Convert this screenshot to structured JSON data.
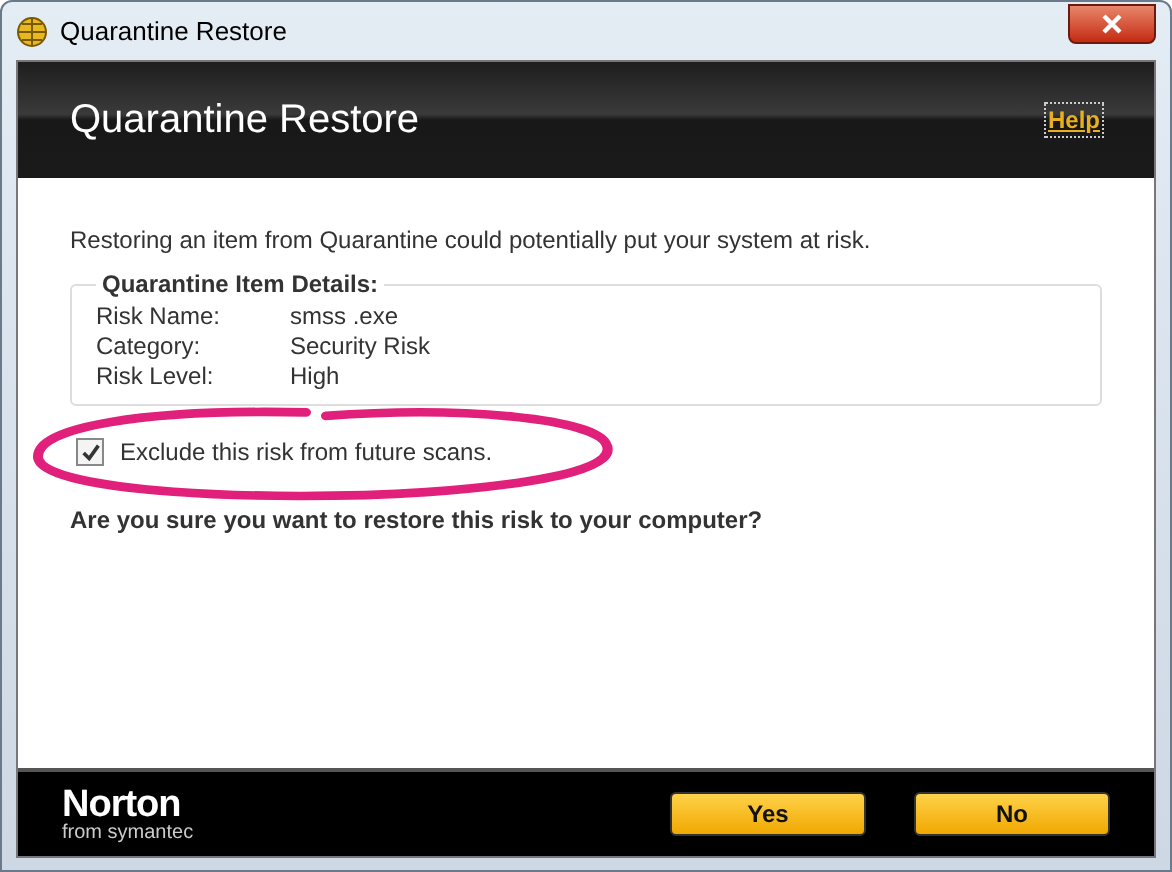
{
  "window": {
    "title": "Quarantine Restore"
  },
  "header": {
    "title": "Quarantine Restore",
    "help_link": "Help"
  },
  "message": "Restoring an item from Quarantine could potentially put your system at risk.",
  "details": {
    "legend": "Quarantine Item Details:",
    "rows": [
      {
        "label": "Risk Name:",
        "value": "smss .exe"
      },
      {
        "label": "Category:",
        "value": "Security Risk"
      },
      {
        "label": "Risk Level:",
        "value": "High"
      }
    ]
  },
  "exclude_option": {
    "label": "Exclude this risk from future scans.",
    "checked": true
  },
  "question": "Are you sure you want to restore this risk to your computer?",
  "footer": {
    "brand": "Norton",
    "brand_sub": "from symantec",
    "buttons": [
      "Yes",
      "No"
    ]
  }
}
